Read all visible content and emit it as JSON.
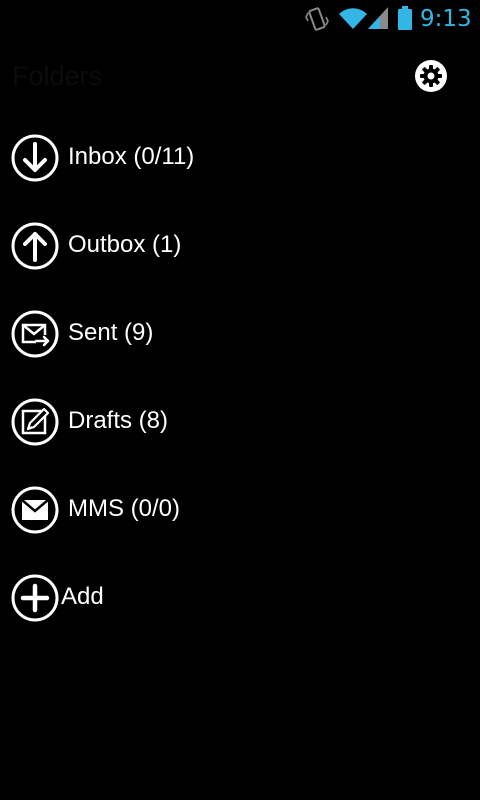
{
  "status_bar": {
    "time": "9:13",
    "accent_color": "#33b5e5",
    "icons": [
      "vibrate-icon",
      "wifi-icon",
      "signal-icon",
      "battery-icon"
    ]
  },
  "header": {
    "title": "Folders",
    "settings_icon": "gear-icon"
  },
  "folders": [
    {
      "label": "Inbox (0/11)",
      "icon": "arrow-down-icon"
    },
    {
      "label": "Outbox (1)",
      "icon": "arrow-up-icon"
    },
    {
      "label": "Sent (9)",
      "icon": "envelope-arrow-icon"
    },
    {
      "label": "Drafts (8)",
      "icon": "pencil-square-icon"
    },
    {
      "label": "MMS (0/0)",
      "icon": "envelope-icon"
    },
    {
      "label": "Add",
      "icon": "plus-icon"
    }
  ]
}
